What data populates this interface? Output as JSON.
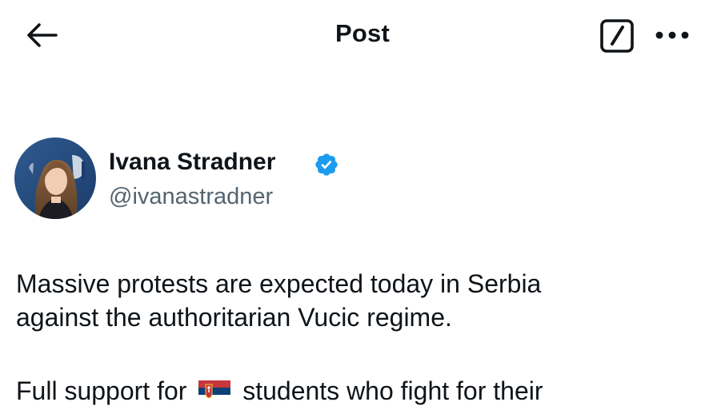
{
  "topbar": {
    "title": "Post",
    "back_icon": "back-arrow-icon",
    "compose_icon": "compose-icon",
    "more_icon": "more-dots-icon"
  },
  "author": {
    "display_name": "Ivana Stradner",
    "handle": "@ivanastradner",
    "verified_icon": "verified-badge-icon",
    "verified_color": "#1d9bf0"
  },
  "tweet": {
    "paragraph_1_line_1": "Massive protests are expected today in Serbia",
    "paragraph_1_line_2": "against the authoritarian Vucic regime.",
    "paragraph_2_prefix": "Full support for",
    "paragraph_2_flag_icon": "serbia-flag-icon",
    "paragraph_2_suffix": "students who fight for their"
  },
  "colors": {
    "text_primary": "#0f1419",
    "text_secondary": "#536471",
    "accent": "#1d9bf0",
    "background": "#ffffff"
  }
}
